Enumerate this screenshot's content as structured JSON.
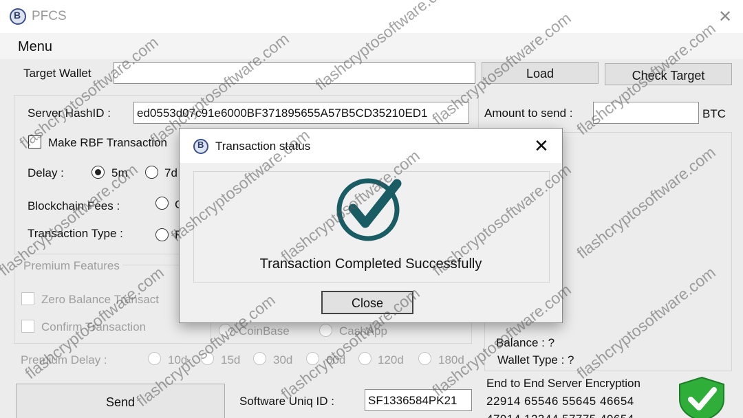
{
  "window": {
    "title": "PFCS",
    "close_glyph": "✕"
  },
  "menu": {
    "label": "Menu"
  },
  "target_wallet": {
    "label": "Target Wallet",
    "value": "",
    "load_button": "Load",
    "check_button": "Check Target"
  },
  "server": {
    "hash_label": "Server HashID :",
    "hash_value": "ed0553d07c91e6000BF371895655A57B5CD35210ED1"
  },
  "amount": {
    "label": "Amount to send :",
    "value": "",
    "unit": "BTC"
  },
  "rbf": {
    "label": "Make RBF Transaction"
  },
  "delay": {
    "label": "Delay :",
    "options": [
      "5m",
      "7d"
    ],
    "selected": "5m"
  },
  "fees": {
    "label": "Blockchain Fees :",
    "option_partial": "C"
  },
  "tx_type": {
    "label": "Transaction Type :",
    "option_partial": "R"
  },
  "premium": {
    "title": "Premium Features",
    "zero_balance": "Zero Balance Transact",
    "confirm": "Confirm Transaction",
    "coinbase": "CoinBase",
    "cashapp": "CashApp",
    "delay_label": "Premium Delay :",
    "delay_options": [
      "10d",
      "15d",
      "30d",
      "60d",
      "120d",
      "180d"
    ]
  },
  "info": {
    "balance": "Balance : ?",
    "wallet_type": "Wallet Type : ?"
  },
  "encryption": {
    "title": "End to End Server Encryption",
    "line1": "22914 65546 55645 46654",
    "line2": "47914 12344 57775 49654"
  },
  "send": {
    "label": "Send"
  },
  "software_id": {
    "label": "Software Uniq ID :",
    "value": "SF1336584PK21"
  },
  "dialog": {
    "title": "Transaction status",
    "close_glyph": "✕",
    "message": "Transaction Completed Successfully",
    "close_button": "Close"
  },
  "watermark": {
    "text": "flashcryptosoftware.com"
  },
  "colors": {
    "check_teal": "#1a5c63",
    "shield_green": "#2fae3a"
  }
}
